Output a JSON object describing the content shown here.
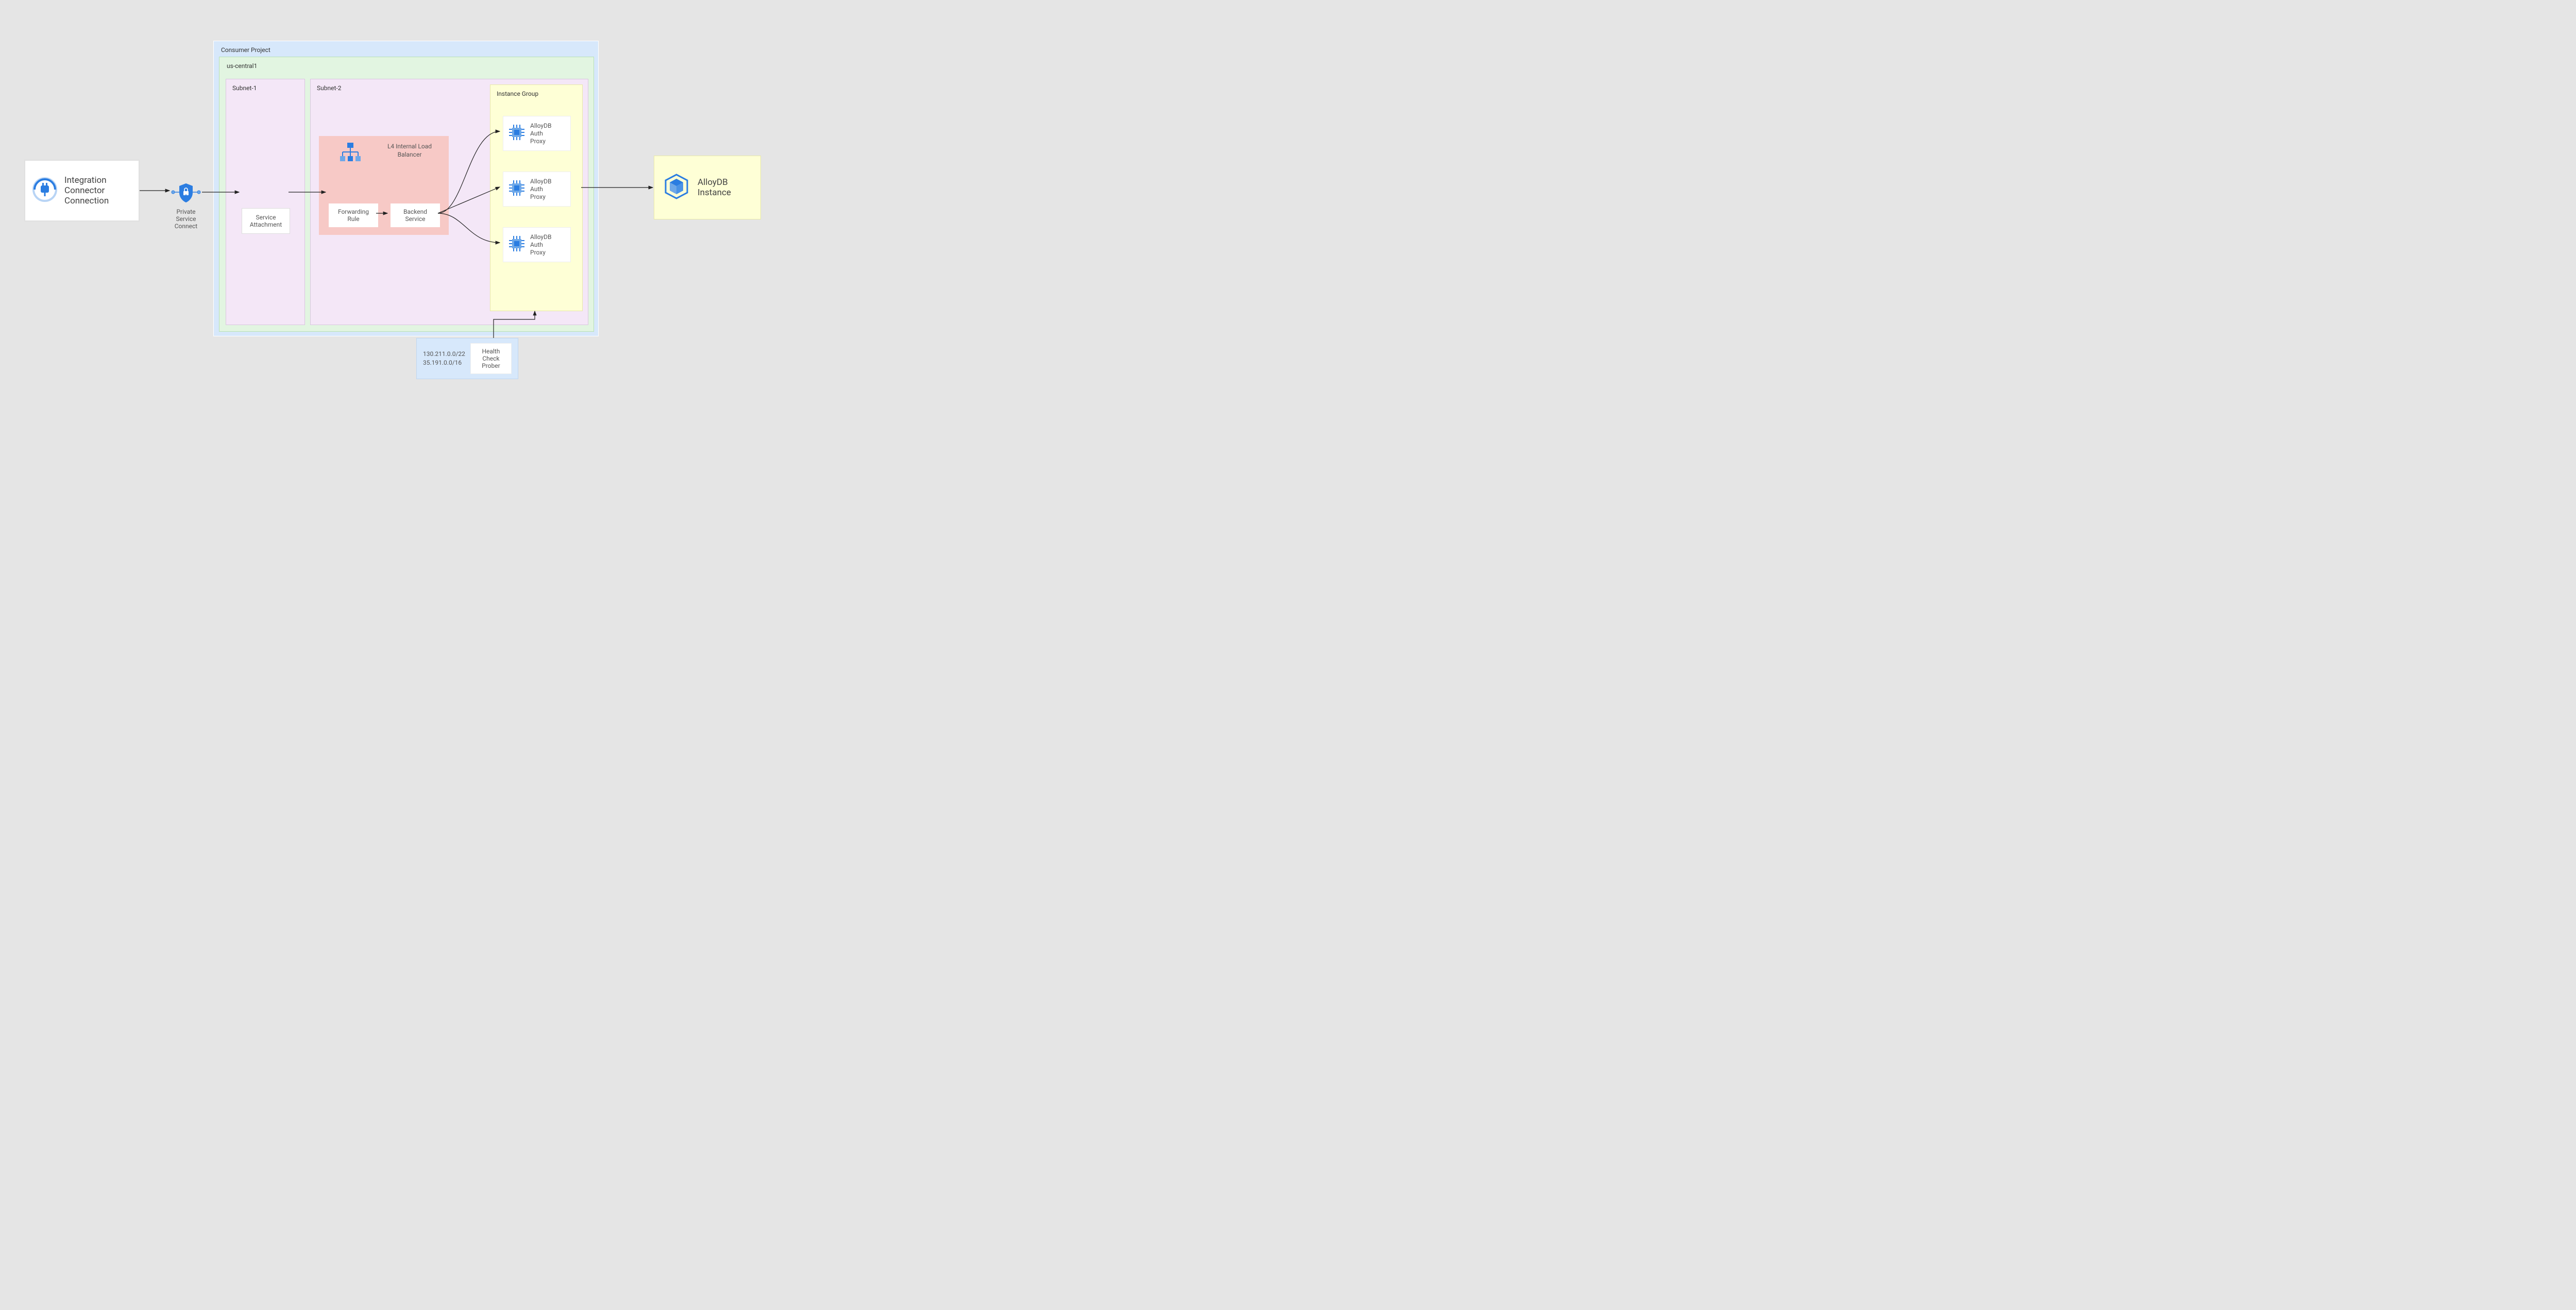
{
  "integration": {
    "label": "Integration\nConnector\nConnection"
  },
  "psc": {
    "label": "Private\nService\nConnect"
  },
  "consumer": {
    "title": "Consumer Project",
    "region": {
      "title": "us-central1",
      "subnet1": {
        "title": "Subnet-1",
        "service_attachment": "Service\nAttachment"
      },
      "subnet2": {
        "title": "Subnet-2",
        "lb": {
          "title": "L4 Internal Load\nBalancer",
          "forwarding_rule": "Forwarding\nRule",
          "backend_service": "Backend\nService"
        },
        "instance_group": {
          "title": "Instance Group",
          "proxies": [
            {
              "label": "AlloyDB\nAuth\nProxy"
            },
            {
              "label": "AlloyDB\nAuth\nProxy"
            },
            {
              "label": "AlloyDB\nAuth\nProxy"
            }
          ]
        }
      }
    }
  },
  "health_check": {
    "ips": "130.211.0.0/22\n35.191.0.0/16",
    "prober": "Health Check\nProber"
  },
  "alloydb": {
    "label": "AlloyDB\nInstance"
  }
}
